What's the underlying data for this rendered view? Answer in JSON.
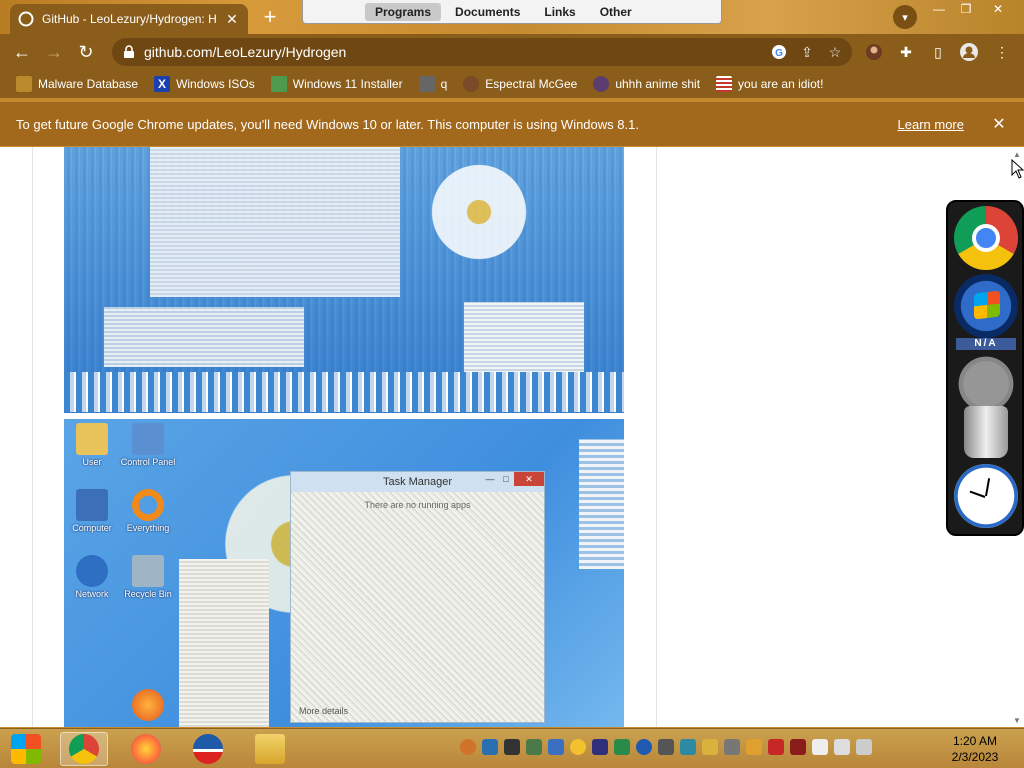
{
  "browser": {
    "tab": {
      "title": "GitHub - LeoLezury/Hydrogen: H",
      "close_glyph": "✕"
    },
    "new_tab_glyph": "+",
    "url": "github.com/LeoLezury/Hydrogen",
    "window_controls": {
      "minimize": "—",
      "restore": "❐",
      "close": "✕"
    }
  },
  "menubar": {
    "items": [
      {
        "label": "Programs",
        "active": true
      },
      {
        "label": "Documents",
        "active": false
      },
      {
        "label": "Links",
        "active": false
      },
      {
        "label": "Other",
        "active": false
      }
    ]
  },
  "bookmarks": [
    {
      "label": "Malware Database",
      "icon": "yellow-folder-icon",
      "color": "#b98a2e"
    },
    {
      "label": "Windows ISOs",
      "icon": "x-icon",
      "color": "#1b3fae"
    },
    {
      "label": "Windows 11 Installer",
      "icon": "image-icon",
      "color": "#4e9a4e"
    },
    {
      "label": "q",
      "icon": "extension-icon",
      "color": "#666666"
    },
    {
      "label": "Espectral McGee",
      "icon": "avatar-icon",
      "color": "#7a4a2a"
    },
    {
      "label": "uhhh anime shit",
      "icon": "anime-icon",
      "color": "#5c3d6f"
    },
    {
      "label": "you are an idiot!",
      "icon": "flag-icon",
      "color": "#c0392b"
    }
  ],
  "infobar": {
    "message": "To get future Google Chrome updates, you'll need Windows 10 or later. This computer is using Windows 8.1.",
    "link": "Learn more",
    "close_glyph": "✕"
  },
  "page": {
    "task_manager": {
      "title": "Task Manager",
      "message": "There are no running apps",
      "details": "More details"
    },
    "desktop_icons": [
      {
        "label": "User"
      },
      {
        "label": "Control Panel"
      },
      {
        "label": "Computer"
      },
      {
        "label": "Everything"
      },
      {
        "label": "Network"
      },
      {
        "label": "Recycle Bin"
      }
    ]
  },
  "gadgets": {
    "na_label": "N/A"
  },
  "taskbar": {
    "time": "1:20 AM",
    "date": "2/3/2023"
  },
  "colors": {
    "chrome_frame": "#8b5d1a",
    "infobar": "#a2681c",
    "taskbar": "#c49a46"
  }
}
